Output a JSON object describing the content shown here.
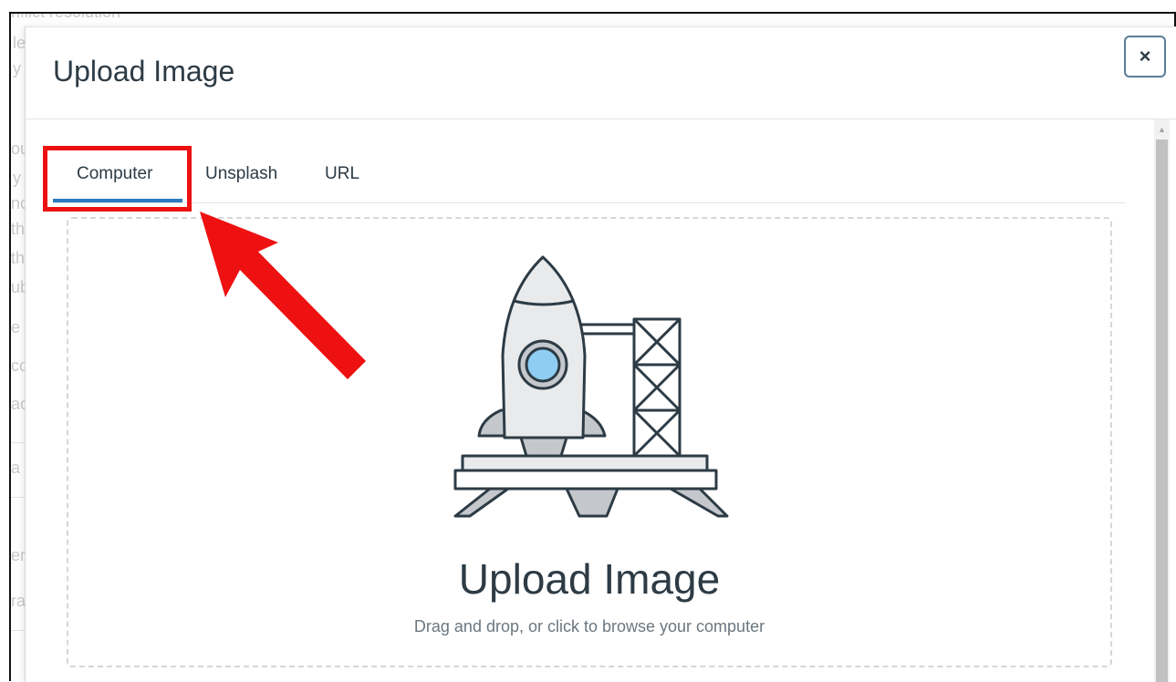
{
  "modal": {
    "title": "Upload Image",
    "close_label": "×"
  },
  "tabs": [
    {
      "label": "Computer",
      "selected": true
    },
    {
      "label": "Unsplash",
      "selected": false
    },
    {
      "label": "URL",
      "selected": false
    }
  ],
  "dropzone": {
    "title": "Upload Image",
    "subtitle": "Drag and drop, or click to browse your computer",
    "illustration_icon": "rocket-launchpad-icon"
  },
  "annotation": {
    "highlight_color": "#ee1111",
    "arrow_icon": "red-pointer-arrow-icon"
  },
  "colors": {
    "accent": "#2b7abc",
    "text": "#2d3b45",
    "muted": "#6b7780"
  },
  "background_fragments": [
    "nflict resolution",
    "le",
    "y",
    "ou",
    "y",
    "nc",
    "th",
    "th",
    "ub",
    "e",
    "co",
    "ac",
    "a",
    "er",
    "ra"
  ]
}
